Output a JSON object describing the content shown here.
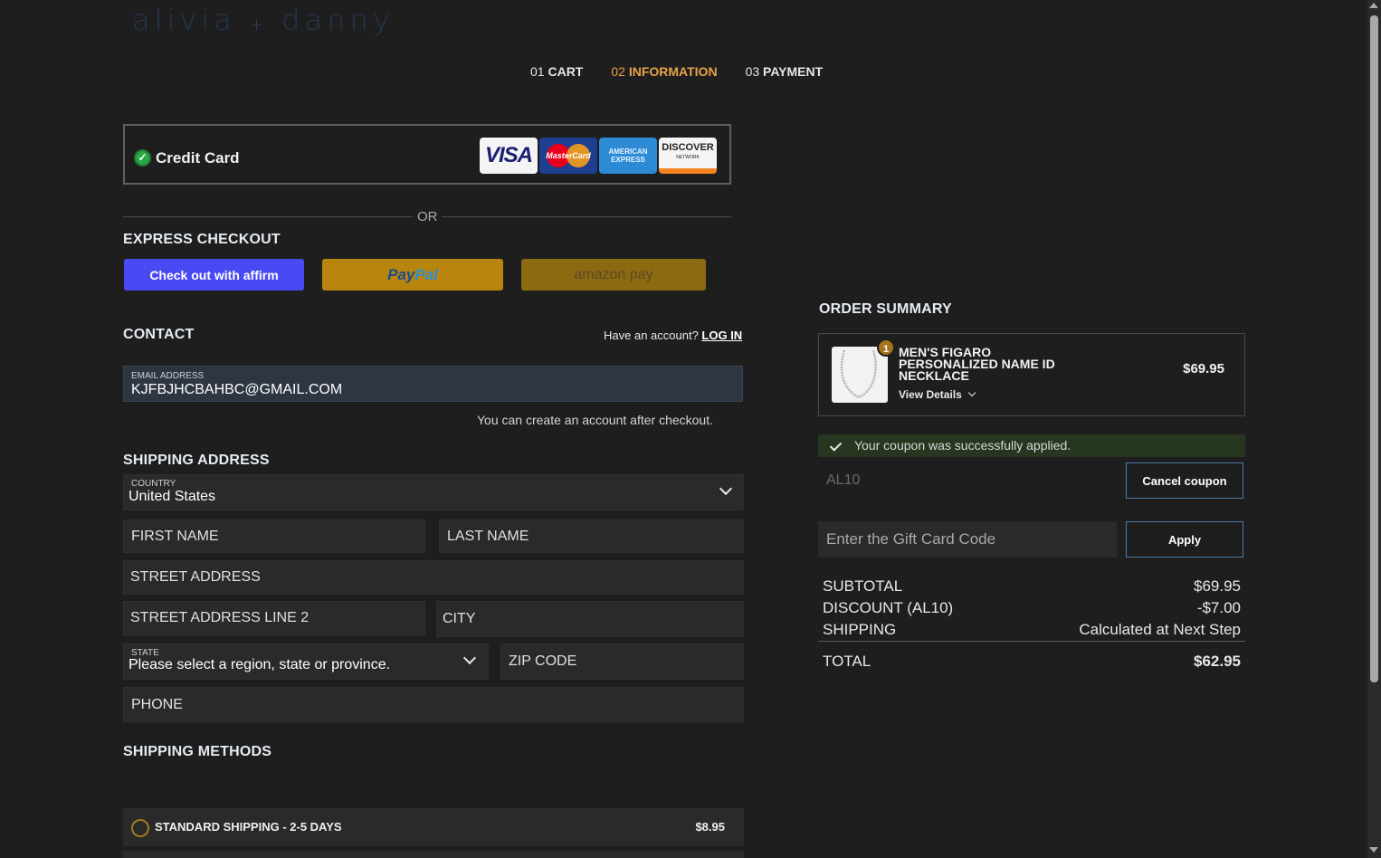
{
  "brand": {
    "logo_left": "alivia",
    "logo_plus": "+",
    "logo_right": "danny"
  },
  "steps": [
    {
      "num": "01",
      "label": "CART",
      "active": false
    },
    {
      "num": "02",
      "label": "INFORMATION",
      "active": true
    },
    {
      "num": "03",
      "label": "PAYMENT",
      "active": false
    }
  ],
  "payment": {
    "method_label": "Credit Card",
    "cards": {
      "visa": "VISA",
      "mastercard": "MasterCard",
      "amex": "AMERICAN EXPRESS",
      "discover": "DISCOVER",
      "discover_sub": "NETWORK"
    },
    "or_text": "OR"
  },
  "express": {
    "title": "EXPRESS CHECKOUT",
    "affirm_label": "Check out with affirm",
    "paypal_pay": "Pay",
    "paypal_pal": "Pal",
    "amazon_label": "amazon pay"
  },
  "contact": {
    "title": "CONTACT",
    "have_account": "Have an account?",
    "login_link": "LOG IN",
    "email_label": "EMAIL ADDRESS",
    "email_value": "KJFBJHCBAHBC@GMAIL.COM",
    "create_note": "You can create an account after checkout."
  },
  "shipping_address": {
    "title": "SHIPPING ADDRESS",
    "country_label": "COUNTRY",
    "country_value": "United States",
    "first_name": "FIRST NAME",
    "last_name": "LAST NAME",
    "street": "STREET ADDRESS",
    "street2": "STREET ADDRESS LINE 2",
    "city": "CITY",
    "state_label": "STATE",
    "state_value": "Please select a region, state or province.",
    "zip": "ZIP CODE",
    "phone": "PHONE"
  },
  "shipping_methods": {
    "title": "SHIPPING METHODS",
    "options": [
      {
        "label": "STANDARD SHIPPING - 2-5 DAYS",
        "price": "$8.95"
      }
    ]
  },
  "order_summary": {
    "title": "ORDER SUMMARY",
    "product": {
      "qty": "1",
      "name": "MEN'S FIGARO PERSONALIZED NAME ID NECKLACE",
      "view_details": "View Details",
      "price": "$69.95"
    },
    "coupon_success": "Your coupon was successfully applied.",
    "coupon_code": "AL10",
    "cancel_coupon": "Cancel coupon",
    "gift_placeholder": "Enter the Gift Card Code",
    "apply": "Apply",
    "subtotal_label": "SUBTOTAL",
    "subtotal": "$69.95",
    "discount_label": "DISCOUNT (AL10)",
    "discount": "-$7.00",
    "shipping_label": "SHIPPING",
    "shipping": "Calculated at Next Step",
    "total_label": "TOTAL",
    "total": "$62.95"
  },
  "colors": {
    "accent": "#e8a34a",
    "affirm": "#4a4af4",
    "paypal": "#b8850e",
    "amazon": "#8c6a12",
    "coupon_bg": "#27361f"
  }
}
